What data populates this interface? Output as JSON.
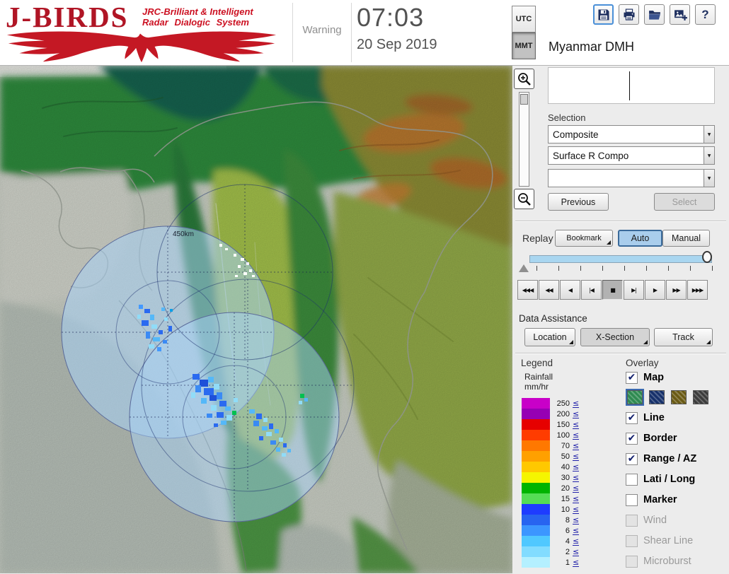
{
  "header": {
    "logo": {
      "title": "J-BIRDS",
      "subtitle_line1": "JRC-Brilliant & Intelligent",
      "subtitle_line2": "Radar  Dialogic  System"
    },
    "warning_label": "Warning",
    "clock": {
      "time": "07:03",
      "date": "20 Sep 2019"
    },
    "timezone": {
      "utc_label": "UTC",
      "mmt_label": "MMT",
      "selected": "MMT"
    },
    "station_name": "Myanmar DMH",
    "toolbar_icons": [
      "floppy-save",
      "printer",
      "folder-open",
      "image-add",
      "question-help"
    ],
    "help_glyph": "?"
  },
  "map": {
    "range_ring_label": "450km",
    "controls": {
      "zoom_in_icon": "magnifier-plus",
      "zoom_out_icon": "magnifier-minus"
    }
  },
  "selection": {
    "label": "Selection",
    "category_dropdown": "Composite",
    "product_dropdown": "Surface R Compo",
    "extra_dropdown": "",
    "previous_button": "Previous",
    "select_button": "Select"
  },
  "replay": {
    "label": "Replay",
    "bookmark_button": "Bookmark",
    "auto_button": "Auto",
    "manual_button": "Manual",
    "mode_selected": "Auto",
    "transport": [
      {
        "name": "fast-rewind",
        "glyph": "◀◀◀"
      },
      {
        "name": "rewind",
        "glyph": "◀◀"
      },
      {
        "name": "reverse-play",
        "glyph": "◀"
      },
      {
        "name": "step-back",
        "glyph": "|◀"
      },
      {
        "name": "stop",
        "glyph": "■",
        "pressed": true
      },
      {
        "name": "step-forward",
        "glyph": "▶|"
      },
      {
        "name": "play",
        "glyph": "▶"
      },
      {
        "name": "forward",
        "glyph": "▶▶"
      },
      {
        "name": "fast-forward",
        "glyph": "▶▶▶"
      }
    ]
  },
  "data_assistance": {
    "label": "Data Assistance",
    "location_button": "Location",
    "xsection_button": "X-Section",
    "track_button": "Track"
  },
  "legend": {
    "label": "Legend",
    "unit_line1": "Rainfall",
    "unit_line2": "mm/hr",
    "operator": "≤",
    "levels": [
      {
        "value": "250",
        "color": "#c800c8"
      },
      {
        "value": "200",
        "color": "#9600b4"
      },
      {
        "value": "150",
        "color": "#e60000"
      },
      {
        "value": "100",
        "color": "#ff3c00"
      },
      {
        "value": "70",
        "color": "#ff7800"
      },
      {
        "value": "50",
        "color": "#ffa000"
      },
      {
        "value": "40",
        "color": "#ffc800"
      },
      {
        "value": "30",
        "color": "#f5f500"
      },
      {
        "value": "20",
        "color": "#00b400"
      },
      {
        "value": "15",
        "color": "#55dd55"
      },
      {
        "value": "10",
        "color": "#1e3cff"
      },
      {
        "value": "8",
        "color": "#2864f0"
      },
      {
        "value": "6",
        "color": "#3c96ff"
      },
      {
        "value": "4",
        "color": "#50c8ff"
      },
      {
        "value": "2",
        "color": "#82dcff"
      },
      {
        "value": "1",
        "color": "#b4f0ff"
      }
    ]
  },
  "overlay": {
    "label": "Overlay",
    "items": [
      {
        "label": "Map",
        "checked": true,
        "enabled": true
      },
      {
        "label": "Line",
        "checked": true,
        "enabled": true
      },
      {
        "label": "Border",
        "checked": true,
        "enabled": true
      },
      {
        "label": "Range / AZ",
        "checked": true,
        "enabled": true
      },
      {
        "label": "Lati / Long",
        "checked": false,
        "enabled": true
      },
      {
        "label": "Marker",
        "checked": false,
        "enabled": true
      },
      {
        "label": "Wind",
        "checked": false,
        "enabled": false
      },
      {
        "label": "Shear Line",
        "checked": false,
        "enabled": false
      },
      {
        "label": "Microburst",
        "checked": false,
        "enabled": false
      }
    ],
    "map_styles": [
      {
        "name": "terrain-green",
        "color": "#2e8a50",
        "selected": true
      },
      {
        "name": "terrain-navy",
        "color": "#16306a",
        "selected": false
      },
      {
        "name": "terrain-olive",
        "color": "#6a5a14",
        "selected": false
      },
      {
        "name": "terrain-gray",
        "color": "#3c3c3c",
        "selected": false
      }
    ]
  },
  "ui": {
    "check_glyph": "✔",
    "dropdown_arrow": "▼",
    "colors": {
      "brand_red": "#cc1122",
      "accent_blue": "#a9cdec"
    }
  }
}
